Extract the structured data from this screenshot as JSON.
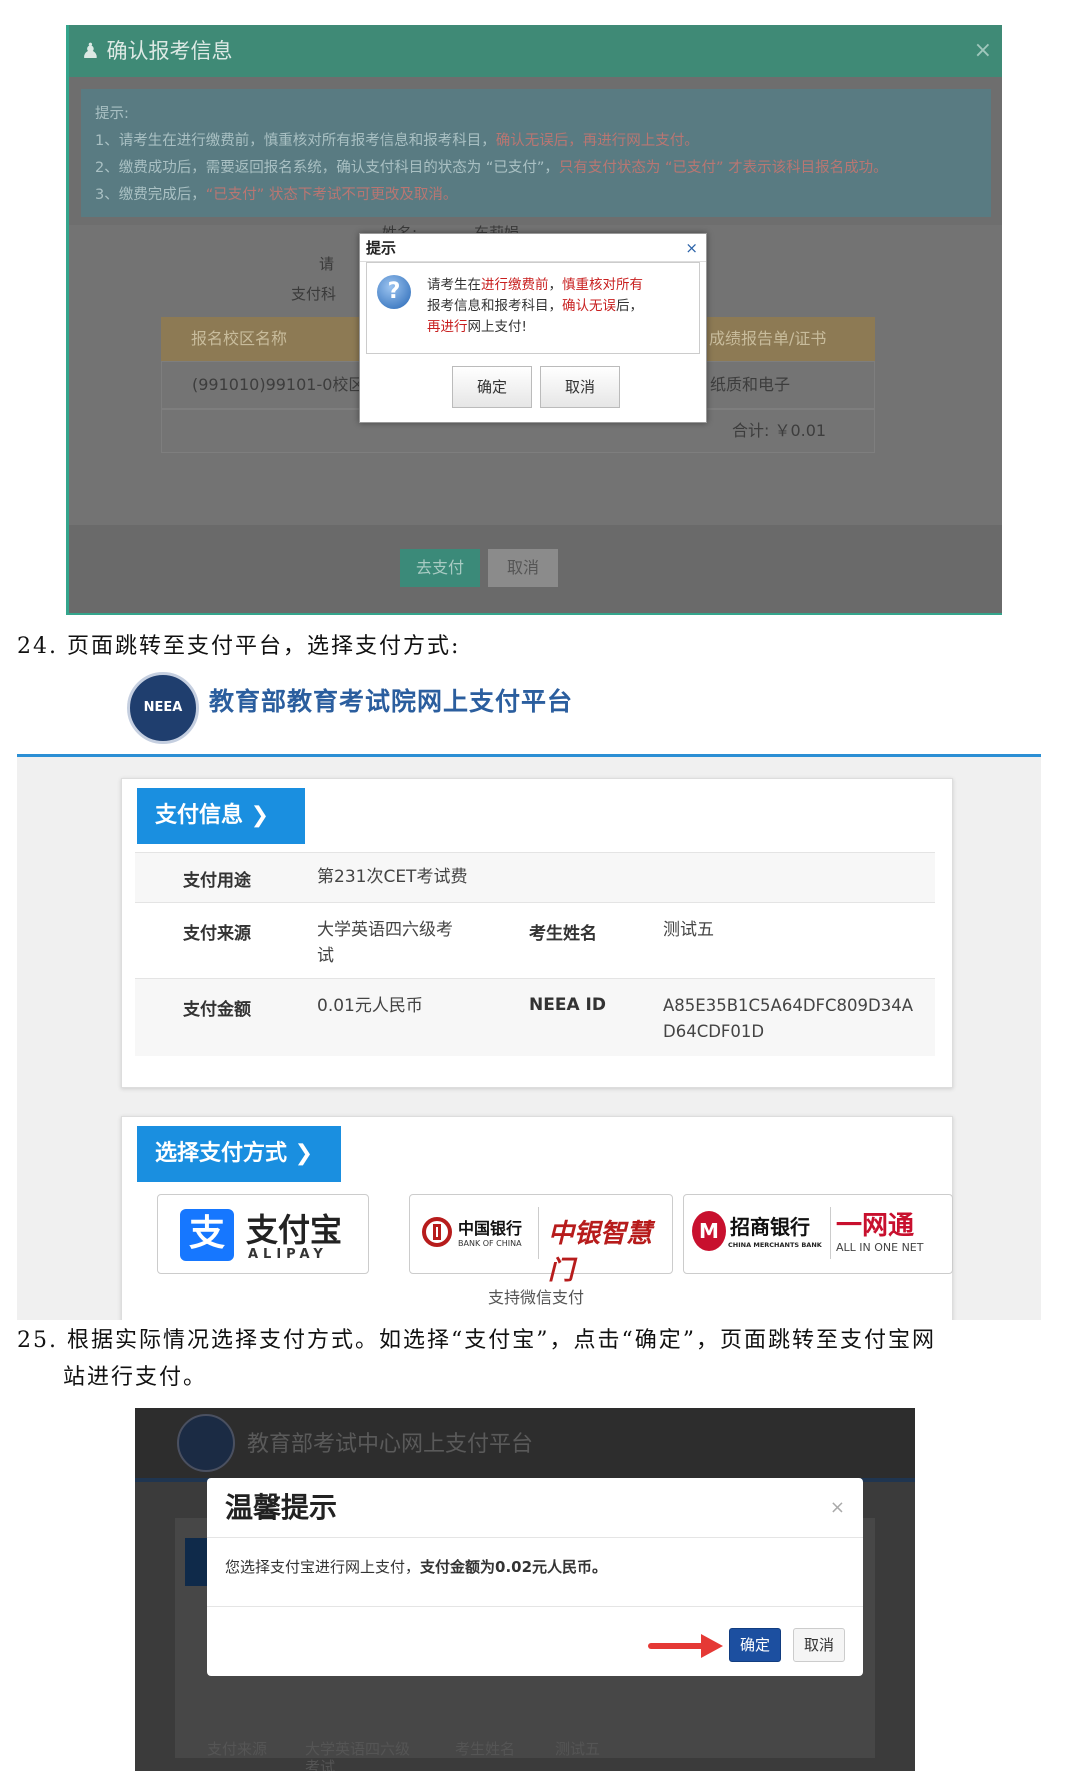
{
  "shot1": {
    "title": "确认报考信息",
    "tips_head": "提示:",
    "tip1_a": "1、请考生在进行缴费前，慎重核对所有报考信息和报考科目，",
    "tip1_b": "确认无误后，再进行网上支付。",
    "tip2_a": "2、缴费成功后，需要返回报名系统，确认支付科目的状态为 “已支付”，",
    "tip2_b": "只有支付状态为 “已支付” 才表示该科目报名成功。",
    "tip3_a": "3、缴费完成后，",
    "tip3_b": "“已支付” 状态下考试不可更改及取消。",
    "bg_name_label": "姓名:",
    "bg_name_value": "东莉娟",
    "bg_pay_label": "支付科",
    "bg_char": "请",
    "col_campus": "报名校区名称",
    "col_report": "成绩报告单/证书",
    "row_campus": "(991010)99101-0校区",
    "row_report": "纸质和电子",
    "total": "合计: ￥0.01",
    "btn_pay": "去支付",
    "btn_cancel": "取消",
    "dialog": {
      "title": "提示",
      "close": "×",
      "msg_1": "请考生在",
      "msg_2": "进行缴费前",
      "msg_3": "，",
      "msg_4": "慎重核对所有",
      "msg_5": "报考信息和报考科目，",
      "msg_6": "确认无误",
      "msg_7": "后，",
      "msg_8": "再进行",
      "msg_9": "网上支付!",
      "ok": "确定",
      "cancel": "取消"
    }
  },
  "caption24": "24. 页面跳转至支付平台，选择支付方式:",
  "shot2": {
    "logo_text": "NEEA",
    "platform_title": "教育部教育考试院网上支付平台",
    "section_pay_info": "支付信息 ❯",
    "purpose_label": "支付用途",
    "purpose_value": "第231次CET考试费",
    "source_label": "支付来源",
    "source_value": "大学英语四六级考试",
    "name_label": "考生姓名",
    "name_value": "测试五",
    "amount_label": "支付金额",
    "amount_value": "0.01元人民币",
    "neea_label": "NEEA ID",
    "neea_value": "A85E35B1C5A64DFC809D34AD64CDF01D",
    "section_method": "选择支付方式 ❯",
    "alipay_glyph": "支",
    "alipay_cn": "支付宝",
    "alipay_en": "ALIPAY",
    "boc_cn": "中国银行",
    "boc_en": "BANK OF CHINA",
    "boc_brand": "中银智慧门",
    "cmb_cn": "招商银行",
    "cmb_en": "CHINA MERCHANTS BANK",
    "cmb_brand": "一网通",
    "cmb_brand_en": "ALL IN ONE NET",
    "wechat_note": "支持微信支付"
  },
  "caption25_l1": "25. 根据实际情况选择支付方式。如选择“支付宝”，点击“确定”，页面跳转至支付宝网",
  "caption25_l2": "站进行支付。",
  "shot3": {
    "platform_title": "教育部考试中心网上支付平台",
    "dialog_title": "温馨提示",
    "close": "×",
    "msg_a": "您选择支付宝进行网上支付，",
    "msg_b": "支付金额为0.02元人民币。",
    "ok": "确定",
    "cancel": "取消",
    "bg_label1": "支付来源",
    "bg_value1": "大学英语四六级",
    "bg_value1b": "考试",
    "bg_label2": "考生姓名",
    "bg_value2": "测试五"
  },
  "colors": {
    "header_green": "#3f8a76",
    "accent_blue": "#1a8fe0",
    "alipay_blue": "#1677ff",
    "boc_red": "#b71c1c",
    "cmb_red": "#c8102e",
    "confirm_navy": "#1c4fa0",
    "arrow_red": "#e53935"
  }
}
